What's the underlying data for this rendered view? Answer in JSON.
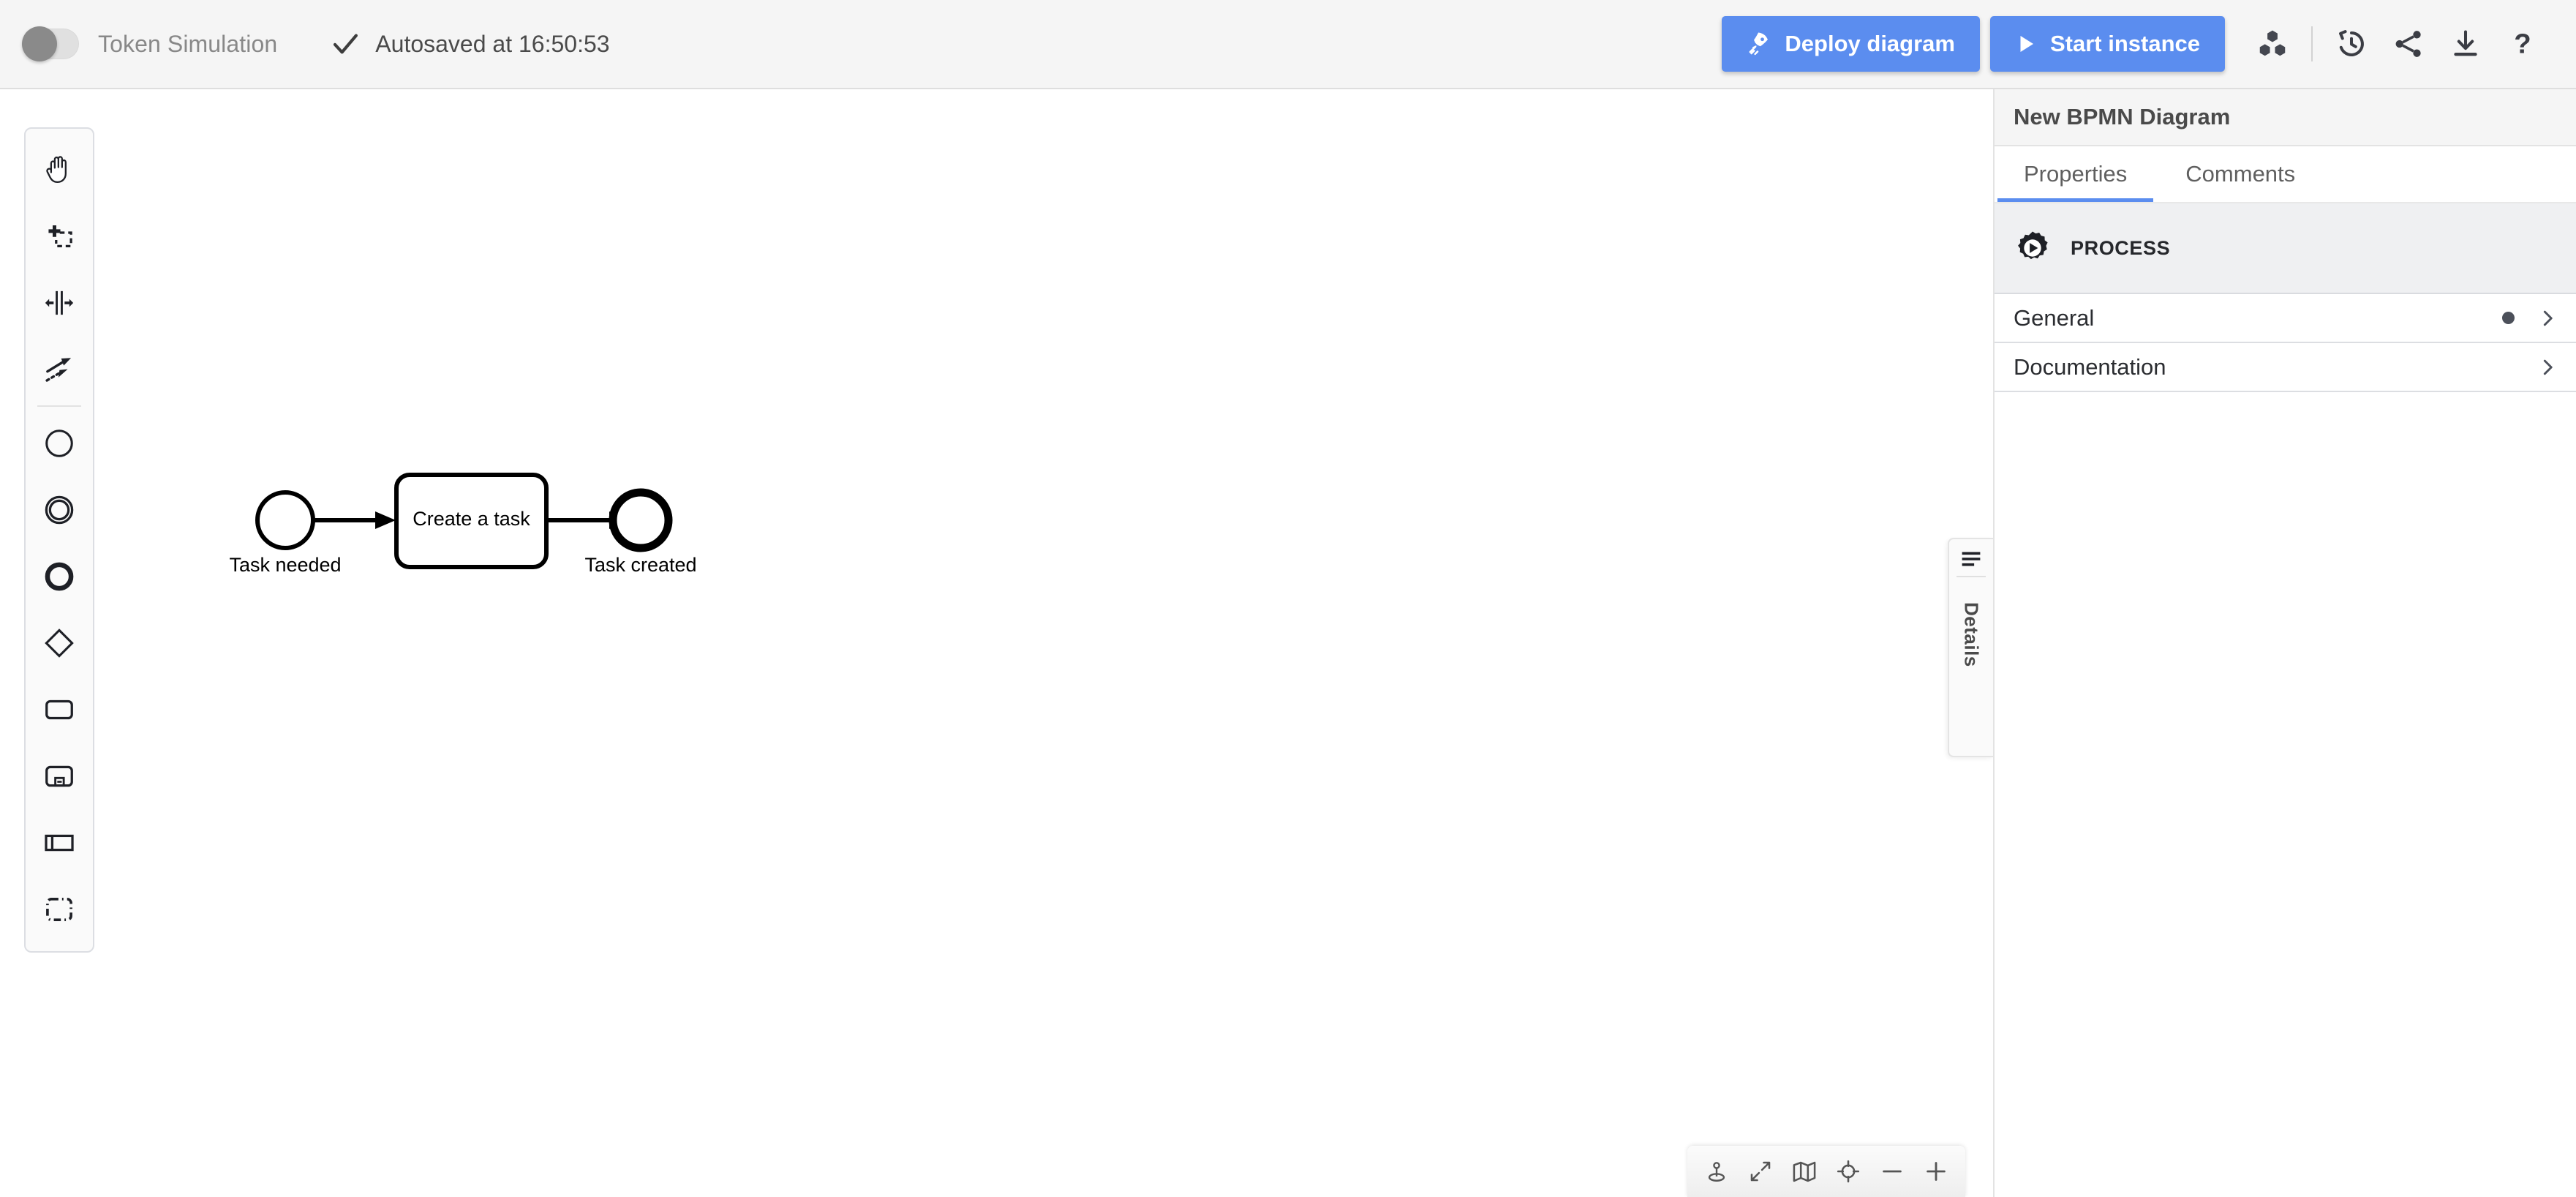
{
  "header": {
    "toggle": {
      "name": "token-simulation-toggle",
      "label": "Token Simulation",
      "state": "off"
    },
    "autosave": {
      "icon": "check-icon",
      "text": "Autosaved at 16:50:53"
    },
    "buttons": [
      {
        "id": "deploy-diagram",
        "label": "Deploy diagram",
        "icon": "rocket-icon",
        "color": "#5b8def"
      },
      {
        "id": "start-instance",
        "label": "Start instance",
        "icon": "play-icon",
        "color": "#5b8def"
      }
    ],
    "icons": [
      {
        "id": "cluster-icon",
        "title": "Cluster"
      },
      {
        "id": "history-icon",
        "title": "History"
      },
      {
        "id": "share-icon",
        "title": "Share"
      },
      {
        "id": "download-icon",
        "title": "Download"
      },
      {
        "id": "help-icon",
        "title": "Help"
      }
    ]
  },
  "palette": {
    "items": [
      {
        "id": "hand-tool",
        "icon": "hand-icon",
        "title": "Activate hand tool"
      },
      {
        "id": "lasso-tool",
        "icon": "lasso-icon",
        "title": "Activate lasso tool"
      },
      {
        "id": "space-tool",
        "icon": "space-tool-icon",
        "title": "Activate create/remove space tool"
      },
      {
        "id": "global-connect-tool",
        "icon": "connect-arrow-icon",
        "title": "Activate global connect tool"
      },
      {
        "id": "create-start-event",
        "icon": "start-event-icon",
        "title": "Create start event"
      },
      {
        "id": "create-intermediate-event",
        "icon": "intermediate-event-icon",
        "title": "Create intermediate/boundary event"
      },
      {
        "id": "create-end-event",
        "icon": "end-event-icon",
        "title": "Create end event"
      },
      {
        "id": "create-gateway",
        "icon": "gateway-icon",
        "title": "Create gateway"
      },
      {
        "id": "create-task",
        "icon": "task-icon",
        "title": "Create task"
      },
      {
        "id": "create-subprocess",
        "icon": "subprocess-icon",
        "title": "Create expanded sub-process"
      },
      {
        "id": "create-participant",
        "icon": "participant-icon",
        "title": "Create pool/participant"
      },
      {
        "id": "create-group",
        "icon": "group-icon",
        "title": "Create group"
      }
    ]
  },
  "diagram": {
    "elements": [
      {
        "id": "start-event",
        "type": "startEvent",
        "label": "Task needed"
      },
      {
        "id": "task-create-a-task",
        "type": "task",
        "label": "Create a task"
      },
      {
        "id": "end-event",
        "type": "endEvent",
        "label": "Task created"
      }
    ],
    "flows": [
      {
        "id": "flow-1",
        "from": "start-event",
        "to": "task-create-a-task"
      },
      {
        "id": "flow-2",
        "from": "task-create-a-task",
        "to": "end-event"
      }
    ]
  },
  "details_tab": {
    "label": "Details",
    "icon": "lines-icon"
  },
  "canvas_toolbar": {
    "buttons": [
      {
        "id": "pin-tool",
        "icon": "pin-icon",
        "title": "Pin"
      },
      {
        "id": "fit-viewport",
        "icon": "expand-arrows-icon",
        "title": "Fit diagram to viewport"
      },
      {
        "id": "toggle-minimap",
        "icon": "map-icon",
        "title": "Toggle minimap"
      },
      {
        "id": "reset-zoom",
        "icon": "crosshair-icon",
        "title": "Reset zoom"
      },
      {
        "id": "zoom-out",
        "icon": "minus-icon",
        "title": "Zoom out"
      },
      {
        "id": "zoom-in",
        "icon": "plus-icon",
        "title": "Zoom in"
      }
    ]
  },
  "panel": {
    "title": "New BPMN Diagram",
    "tabs": [
      {
        "id": "tab-properties",
        "label": "Properties",
        "active": true
      },
      {
        "id": "tab-comments",
        "label": "Comments",
        "active": false
      }
    ],
    "group": {
      "icon": "process-gear-icon",
      "label": "PROCESS"
    },
    "rows": [
      {
        "id": "row-general",
        "label": "General",
        "has_dot": true,
        "chevron": "chevron-right-icon"
      },
      {
        "id": "row-documentation",
        "label": "Documentation",
        "has_dot": false,
        "chevron": "chevron-right-icon"
      }
    ]
  },
  "colors": {
    "accent": "#5b8def",
    "header_bg": "#f5f5f5",
    "panel_group_bg": "#eff0f2",
    "dot": "#4c505a"
  }
}
